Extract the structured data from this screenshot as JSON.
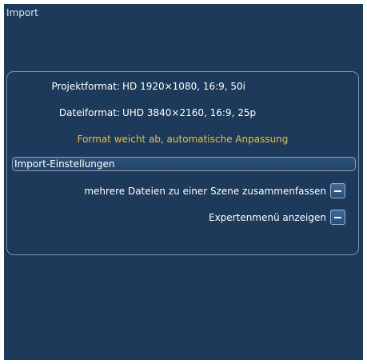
{
  "window": {
    "title": "Import"
  },
  "info": {
    "project_label": "Projektformat:",
    "project_value": "HD 1920×1080, 16:9, 50i",
    "file_label": "Dateiformat:",
    "file_value": "UHD 3840×2160, 16:9, 25p",
    "warning": "Format weicht ab, automatische Anpassung"
  },
  "section": {
    "label": "Import-Einstellungen"
  },
  "options": [
    {
      "label": "mehrere Dateien zu einer Szene zusammenfassen",
      "state": "off"
    },
    {
      "label": "Expertenmenü anzeigen",
      "state": "off"
    }
  ],
  "colors": {
    "background": "#1d3a5b",
    "warning": "#e6c03a",
    "border": "#7f93ad"
  }
}
